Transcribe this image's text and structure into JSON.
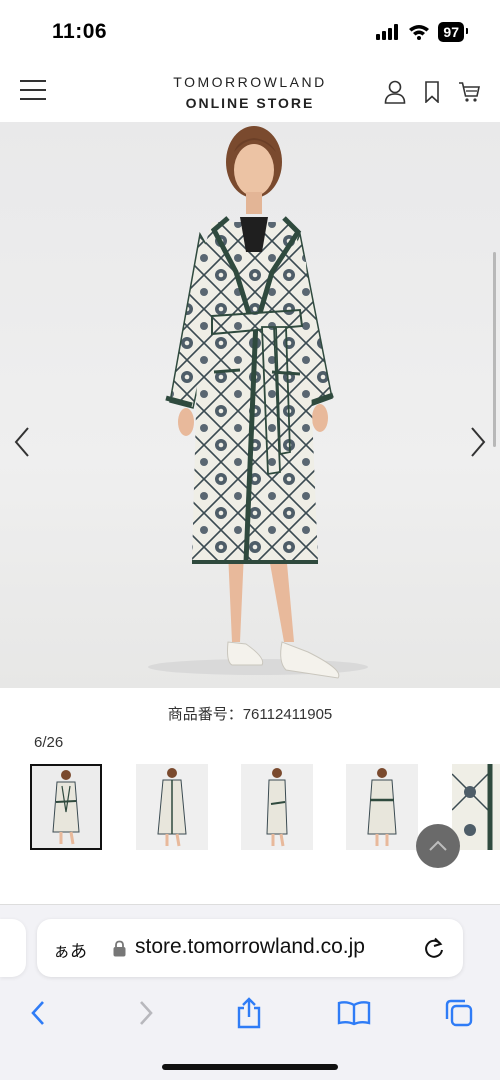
{
  "status_bar": {
    "time": "11:06",
    "battery": "97"
  },
  "header": {
    "brand_line1": "TOMORROWLAND",
    "brand_line2": "ONLINE STORE"
  },
  "product": {
    "code_label": "商品番号：76112411905",
    "image_counter": "6/26"
  },
  "browser": {
    "aa_label": "ぁあ",
    "url": "store.tomorrowland.co.jp"
  },
  "colors": {
    "accent_green": "#2f4a3e",
    "coat_cream": "#efeee6",
    "page_bg": "#ffffff",
    "browser_blue": "#2f7cf6"
  }
}
